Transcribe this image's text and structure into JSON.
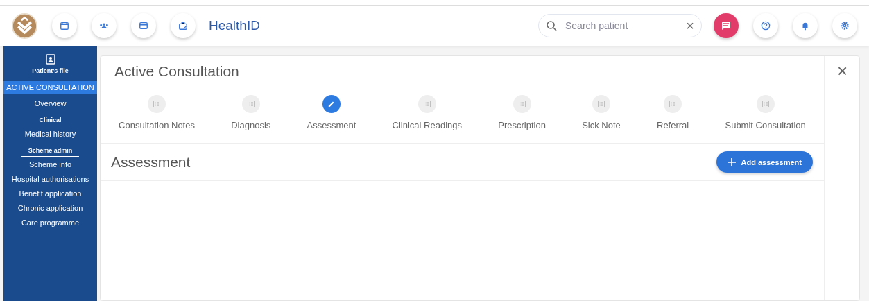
{
  "header": {
    "title": "HealthID",
    "search": {
      "placeholder": "Search patient",
      "clear": "×"
    }
  },
  "sidebar": {
    "patient_file": "Patient's file",
    "items": [
      {
        "kind": "item",
        "label": "ACTIVE CONSULTATION",
        "selected": true
      },
      {
        "kind": "item",
        "label": "Overview",
        "selected": false
      },
      {
        "kind": "heading",
        "label": "Clinical"
      },
      {
        "kind": "item",
        "label": "Medical history",
        "selected": false
      },
      {
        "kind": "heading",
        "label": "Scheme admin"
      },
      {
        "kind": "item",
        "label": "Scheme info",
        "selected": false
      },
      {
        "kind": "item",
        "label": "Hospital authorisations",
        "selected": false
      },
      {
        "kind": "item",
        "label": "Benefit application",
        "selected": false
      },
      {
        "kind": "item",
        "label": "Chronic application",
        "selected": false
      },
      {
        "kind": "item",
        "label": "Care programme",
        "selected": false
      }
    ]
  },
  "card": {
    "title": "Active Consultation",
    "close": "×",
    "steps": [
      {
        "label": "Consultation Notes",
        "selected": false
      },
      {
        "label": "Diagnosis",
        "selected": false
      },
      {
        "label": "Assessment",
        "selected": true
      },
      {
        "label": "Clinical Readings",
        "selected": false
      },
      {
        "label": "Prescription",
        "selected": false
      },
      {
        "label": "Sick Note",
        "selected": false
      },
      {
        "label": "Referral",
        "selected": false
      },
      {
        "label": "Submit Consultation",
        "selected": false
      }
    ],
    "section": {
      "title": "Assessment",
      "button": "Add assessment"
    }
  }
}
